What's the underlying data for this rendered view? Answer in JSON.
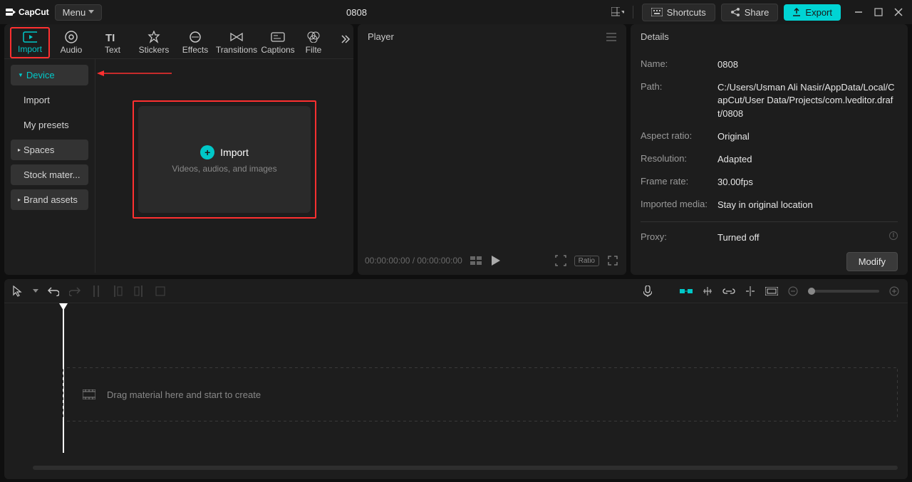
{
  "app": {
    "name": "CapCut",
    "project_title": "0808",
    "menu_label": "Menu"
  },
  "topbar": {
    "shortcuts": "Shortcuts",
    "share": "Share",
    "export": "Export"
  },
  "tabs": [
    {
      "id": "import",
      "label": "Import"
    },
    {
      "id": "audio",
      "label": "Audio"
    },
    {
      "id": "text",
      "label": "Text"
    },
    {
      "id": "stickers",
      "label": "Stickers"
    },
    {
      "id": "effects",
      "label": "Effects"
    },
    {
      "id": "transitions",
      "label": "Transitions"
    },
    {
      "id": "captions",
      "label": "Captions"
    },
    {
      "id": "filters",
      "label": "Filte"
    }
  ],
  "sidebar": {
    "items": [
      {
        "label": "Device",
        "sel": true,
        "caret": true,
        "bg": true
      },
      {
        "label": "Import",
        "sel": false,
        "caret": false,
        "bg": false
      },
      {
        "label": "My presets",
        "sel": false,
        "caret": false,
        "bg": false
      },
      {
        "label": "Spaces",
        "sel": false,
        "caret": true,
        "bg": true
      },
      {
        "label": "Stock mater...",
        "sel": false,
        "caret": false,
        "bg": true
      },
      {
        "label": "Brand assets",
        "sel": false,
        "caret": true,
        "bg": true
      }
    ]
  },
  "import_card": {
    "title": "Import",
    "subtitle": "Videos, audios, and images"
  },
  "player": {
    "title": "Player",
    "timecode": "00:00:00:00 / 00:00:00:00",
    "ratio": "Ratio"
  },
  "details": {
    "title": "Details",
    "rows": {
      "name": {
        "label": "Name:",
        "value": "0808"
      },
      "path": {
        "label": "Path:",
        "value": "C:/Users/Usman Ali Nasir/AppData/Local/CapCut/User Data/Projects/com.lveditor.draft/0808"
      },
      "aspect": {
        "label": "Aspect ratio:",
        "value": "Original"
      },
      "resolution": {
        "label": "Resolution:",
        "value": "Adapted"
      },
      "framerate": {
        "label": "Frame rate:",
        "value": "30.00fps"
      },
      "imported": {
        "label": "Imported media:",
        "value": "Stay in original location"
      },
      "proxy": {
        "label": "Proxy:",
        "value": "Turned off"
      }
    },
    "modify": "Modify"
  },
  "timeline": {
    "placeholder": "Drag material here and start to create"
  }
}
